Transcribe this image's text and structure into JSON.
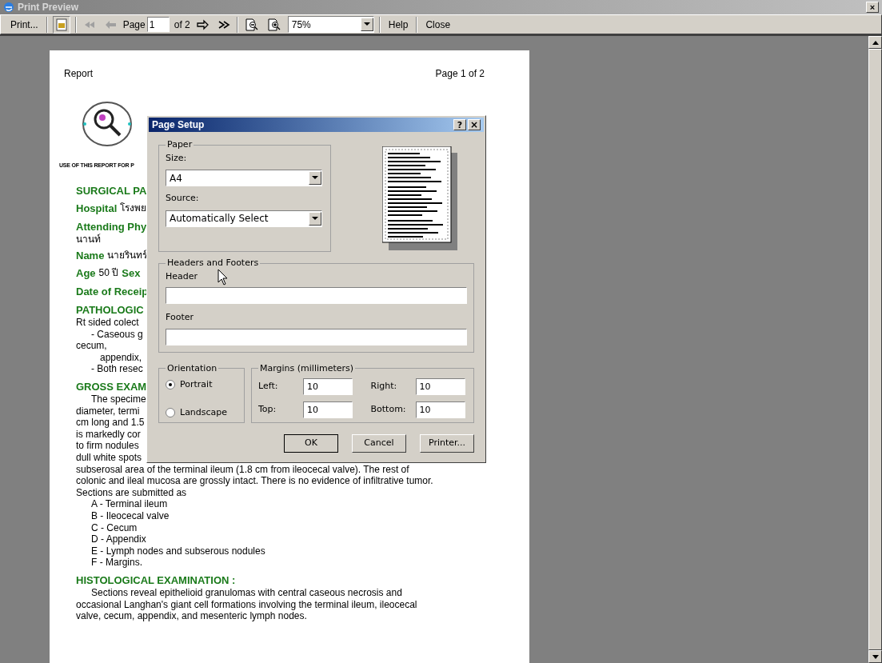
{
  "window": {
    "title": "Print Preview",
    "close": "×"
  },
  "toolbar": {
    "print": "Print...",
    "nav_back": [
      {
        "kind": "first",
        "disabled": true
      },
      {
        "kind": "prev",
        "disabled": true
      }
    ],
    "page_label": "Page",
    "page_value": "1",
    "page_count": "of 2",
    "nav_forward": [
      {
        "kind": "next",
        "disabled": false
      },
      {
        "kind": "last",
        "disabled": false
      }
    ],
    "zoom": "75%",
    "help": "Help",
    "close": "Close"
  },
  "page": {
    "header_left": "Report",
    "header_right": "Page 1 of 2",
    "disclaimer": "USE OF THIS REPORT FOR P",
    "lines": [
      {
        "kind": "heading",
        "text": "SURGICAL PA"
      },
      {
        "kind": "field",
        "label": "Hospital",
        "value": "โรงพย"
      },
      {
        "kind": "heading",
        "text": "Attending Phy"
      },
      {
        "kind": "text",
        "text": "นานท์"
      },
      {
        "kind": "field",
        "label": "Name",
        "value": "นายรินทร์"
      },
      {
        "kind": "field",
        "label": "Age",
        "value": "50 ปี",
        "label2": "Sex"
      },
      {
        "kind": "heading",
        "text": "Date of Receip"
      },
      {
        "kind": "heading",
        "text": "PATHOLOGIC"
      },
      {
        "kind": "text",
        "text": "Rt sided colect"
      },
      {
        "kind": "item",
        "text": "- Caseous g"
      },
      {
        "kind": "text",
        "text": "cecum,"
      },
      {
        "kind": "subitem",
        "text": "appendix,"
      },
      {
        "kind": "item",
        "text": "- Both resec"
      },
      {
        "kind": "heading",
        "text": "GROSS EXAM"
      },
      {
        "kind": "item",
        "text": "The specime"
      },
      {
        "kind": "text",
        "text": "diameter, termi"
      },
      {
        "kind": "text",
        "text": "cm long and 1.5"
      },
      {
        "kind": "text",
        "text": "is markedly cor"
      },
      {
        "kind": "text",
        "text": "to firm nodules"
      },
      {
        "kind": "text",
        "text": "dull white spots"
      },
      {
        "kind": "text",
        "text": "subserosal area of the terminal ileum (1.8 cm from ileocecal valve). The rest of"
      },
      {
        "kind": "text",
        "text": "colonic and ileal mucosa are grossly intact. There is no evidence of infiltrative tumor."
      },
      {
        "kind": "text",
        "text": "Sections are submitted as"
      },
      {
        "kind": "item",
        "text": "A - Terminal ileum"
      },
      {
        "kind": "item",
        "text": "B - Ileocecal valve"
      },
      {
        "kind": "item",
        "text": "C - Cecum"
      },
      {
        "kind": "item",
        "text": "D - Appendix"
      },
      {
        "kind": "item",
        "text": "E - Lymph nodes and subserous nodules"
      },
      {
        "kind": "item",
        "text": "F - Margins."
      },
      {
        "kind": "heading",
        "text": "HISTOLOGICAL EXAMINATION :"
      },
      {
        "kind": "item",
        "text": "Sections reveal epithelioid granulomas with central caseous necrosis and"
      },
      {
        "kind": "text",
        "text": "occasional Langhan's giant cell formations involving the terminal ileum, ileocecal"
      },
      {
        "kind": "text",
        "text": "valve, cecum, appendix, and mesenteric lymph nodes."
      }
    ]
  },
  "dialog": {
    "title": "Page Setup",
    "help": "?",
    "close": "×",
    "paper": {
      "legend": "Paper",
      "size_label": "Size:",
      "size_value": "A4",
      "source_label": "Source:",
      "source_value": "Automatically Select"
    },
    "headers_footers": {
      "legend": "Headers and Footers",
      "header_label": "Header",
      "footer_label": "Footer"
    },
    "orientation": {
      "legend": "Orientation",
      "options": [
        {
          "label": "Portrait",
          "selected": true
        },
        {
          "label": "Landscape",
          "selected": false
        }
      ]
    },
    "margins": {
      "legend": "Margins (millimeters)",
      "fields": [
        {
          "label": "Left:",
          "value": "10"
        },
        {
          "label": "Right:",
          "value": "10"
        },
        {
          "label": "Top:",
          "value": "10"
        },
        {
          "label": "Bottom:",
          "value": "10"
        }
      ]
    },
    "buttons": [
      "OK",
      "Cancel",
      "Printer..."
    ]
  }
}
